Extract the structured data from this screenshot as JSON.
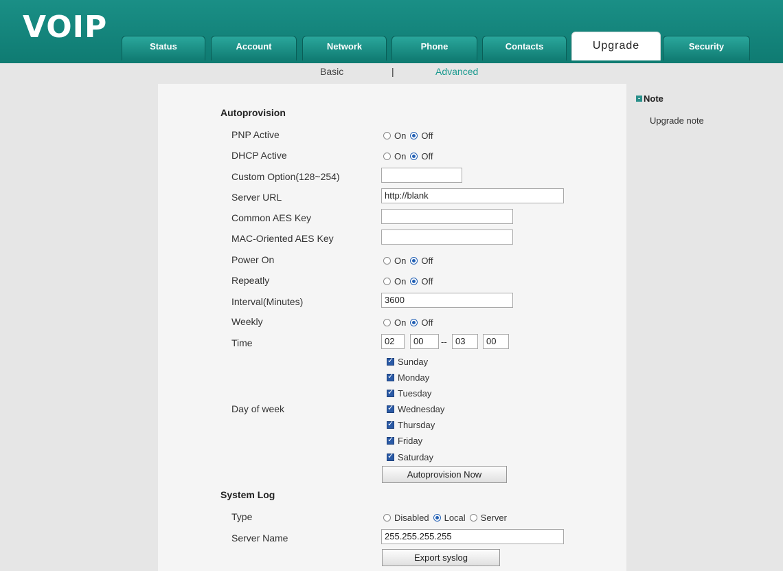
{
  "app": {
    "logo": "VOIP"
  },
  "tabs": [
    "Status",
    "Account",
    "Network",
    "Phone",
    "Contacts",
    "Upgrade",
    "Security"
  ],
  "subnav": {
    "basic": "Basic",
    "separator": "|",
    "advanced": "Advanced"
  },
  "autoprovision": {
    "title": "Autoprovision",
    "pnp_label": "PNP Active",
    "dhcp_label": "DHCP Active",
    "custom_option_label": "Custom Option(128~254)",
    "custom_option_value": "",
    "server_url_label": "Server URL",
    "server_url_value": "http://blank",
    "common_aes_label": "Common AES Key",
    "common_aes_value": "",
    "mac_aes_label": "MAC-Oriented AES Key",
    "mac_aes_value": "",
    "power_on_label": "Power On",
    "repeatly_label": "Repeatly",
    "interval_label": "Interval(Minutes)",
    "interval_value": "3600",
    "weekly_label": "Weekly",
    "time_label": "Time",
    "time_start_hour": "02",
    "time_start_min": "00",
    "time_dash": "--",
    "time_end_hour": "03",
    "time_end_min": "00",
    "day_of_week_label": "Day of week",
    "days": [
      "Sunday",
      "Monday",
      "Tuesday",
      "Wednesday",
      "Thursday",
      "Friday",
      "Saturday"
    ],
    "autoprovision_now_button": "Autoprovision Now"
  },
  "radio_text": {
    "on": "On",
    "off": "Off"
  },
  "system_log": {
    "title": "System Log",
    "type_label": "Type",
    "opt_disabled": "Disabled",
    "opt_local": "Local",
    "opt_server": "Server",
    "server_name_label": "Server Name",
    "server_name_value": "255.255.255.255",
    "export_button": "Export syslog"
  },
  "note": {
    "title": "Note",
    "text": "Upgrade note"
  },
  "colors": {
    "header": "#0f7b72",
    "accent_link": "#1a9a8f",
    "radio": "#2360b4"
  }
}
